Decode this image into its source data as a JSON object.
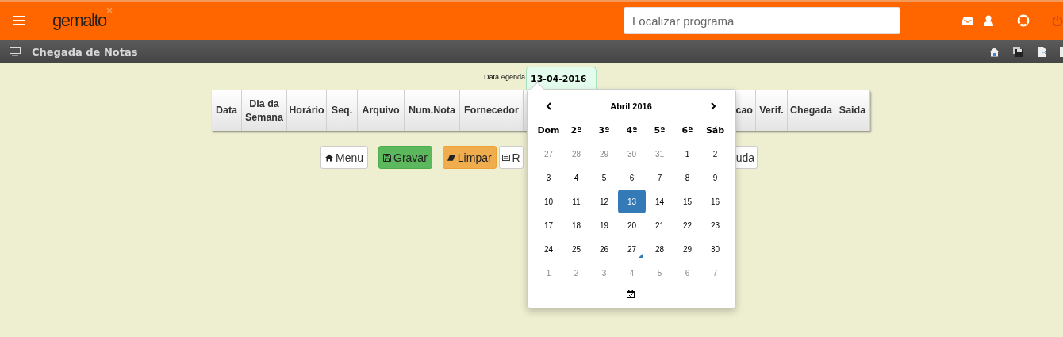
{
  "header": {
    "logo": "gemalto",
    "search": {
      "placeholder": "Localizar programa"
    }
  },
  "page_bar": {
    "title": "Chegada de Notas"
  },
  "form": {
    "date_label": "Data Agenda",
    "date_value": "13-04-2016"
  },
  "table": {
    "columns": [
      {
        "label": "Data",
        "kind": "full"
      },
      {
        "label": "Dia da Semana",
        "kind": "full"
      },
      {
        "label": "Horário",
        "kind": "full"
      },
      {
        "label": "Seq.",
        "kind": "full"
      },
      {
        "label": "Arquivo",
        "kind": "full"
      },
      {
        "label": "Num.Nota",
        "kind": "full"
      },
      {
        "label": "Fornecedor",
        "kind": "full"
      },
      {
        "label": "cao",
        "kind": "partial"
      },
      {
        "label": "Verif.",
        "kind": "full"
      },
      {
        "label": "Chegada",
        "kind": "full"
      },
      {
        "label": "Saida",
        "kind": "full"
      }
    ]
  },
  "buttons": [
    {
      "label": "Menu",
      "kind": "home"
    },
    {
      "label": "Gravar",
      "kind": "save"
    },
    {
      "label": "Limpar",
      "kind": "erase"
    },
    {
      "label": "R",
      "kind": "list"
    },
    {
      "label": "uda",
      "kind": "partial"
    }
  ],
  "calendar": {
    "title": "Abril 2016",
    "weekdays": [
      "Dom",
      "2ª",
      "3ª",
      "4ª",
      "5ª",
      "6ª",
      "Sáb"
    ],
    "weeks": [
      [
        {
          "day": "27",
          "outside": true,
          "selected": false,
          "today": false
        },
        {
          "day": "28",
          "outside": true,
          "selected": false,
          "today": false
        },
        {
          "day": "29",
          "outside": true,
          "selected": false,
          "today": false
        },
        {
          "day": "30",
          "outside": true,
          "selected": false,
          "today": false
        },
        {
          "day": "31",
          "outside": true,
          "selected": false,
          "today": false
        },
        {
          "day": "1",
          "outside": false,
          "selected": false,
          "today": false
        },
        {
          "day": "2",
          "outside": false,
          "selected": false,
          "today": false
        }
      ],
      [
        {
          "day": "3",
          "outside": false,
          "selected": false,
          "today": false
        },
        {
          "day": "4",
          "outside": false,
          "selected": false,
          "today": false
        },
        {
          "day": "5",
          "outside": false,
          "selected": false,
          "today": false
        },
        {
          "day": "6",
          "outside": false,
          "selected": false,
          "today": false
        },
        {
          "day": "7",
          "outside": false,
          "selected": false,
          "today": false
        },
        {
          "day": "8",
          "outside": false,
          "selected": false,
          "today": false
        },
        {
          "day": "9",
          "outside": false,
          "selected": false,
          "today": false
        }
      ],
      [
        {
          "day": "10",
          "outside": false,
          "selected": false,
          "today": false
        },
        {
          "day": "11",
          "outside": false,
          "selected": false,
          "today": false
        },
        {
          "day": "12",
          "outside": false,
          "selected": false,
          "today": false
        },
        {
          "day": "13",
          "outside": false,
          "selected": true,
          "today": false
        },
        {
          "day": "14",
          "outside": false,
          "selected": false,
          "today": false
        },
        {
          "day": "15",
          "outside": false,
          "selected": false,
          "today": false
        },
        {
          "day": "16",
          "outside": false,
          "selected": false,
          "today": false
        }
      ],
      [
        {
          "day": "17",
          "outside": false,
          "selected": false,
          "today": false
        },
        {
          "day": "18",
          "outside": false,
          "selected": false,
          "today": false
        },
        {
          "day": "19",
          "outside": false,
          "selected": false,
          "today": false
        },
        {
          "day": "20",
          "outside": false,
          "selected": false,
          "today": false
        },
        {
          "day": "21",
          "outside": false,
          "selected": false,
          "today": false
        },
        {
          "day": "22",
          "outside": false,
          "selected": false,
          "today": false
        },
        {
          "day": "23",
          "outside": false,
          "selected": false,
          "today": false
        }
      ],
      [
        {
          "day": "24",
          "outside": false,
          "selected": false,
          "today": false
        },
        {
          "day": "25",
          "outside": false,
          "selected": false,
          "today": false
        },
        {
          "day": "26",
          "outside": false,
          "selected": false,
          "today": false
        },
        {
          "day": "27",
          "outside": false,
          "selected": false,
          "today": true
        },
        {
          "day": "28",
          "outside": false,
          "selected": false,
          "today": false
        },
        {
          "day": "29",
          "outside": false,
          "selected": false,
          "today": false
        },
        {
          "day": "30",
          "outside": false,
          "selected": false,
          "today": false
        }
      ],
      [
        {
          "day": "1",
          "outside": true,
          "selected": false,
          "today": false
        },
        {
          "day": "2",
          "outside": true,
          "selected": false,
          "today": false
        },
        {
          "day": "3",
          "outside": true,
          "selected": false,
          "today": false
        },
        {
          "day": "4",
          "outside": true,
          "selected": false,
          "today": false
        },
        {
          "day": "5",
          "outside": true,
          "selected": false,
          "today": false
        },
        {
          "day": "6",
          "outside": true,
          "selected": false,
          "today": false
        },
        {
          "day": "7",
          "outside": true,
          "selected": false,
          "today": false
        }
      ]
    ]
  }
}
